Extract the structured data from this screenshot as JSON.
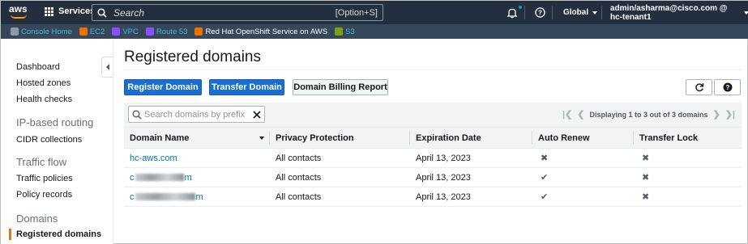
{
  "topnav": {
    "logo_text": "aws",
    "services_label": "Services",
    "search_placeholder": "Search",
    "search_shortcut": "[Option+S]",
    "region_label": "Global",
    "account_label": "admin/asharma@cisco.com @ hc-tenant1"
  },
  "favorites": [
    {
      "label": "Console Home",
      "color": "#8d99a8"
    },
    {
      "label": "EC2",
      "color": "#ed7100"
    },
    {
      "label": "VPC",
      "color": "#8c4fff"
    },
    {
      "label": "Route 53",
      "color": "#8c4fff"
    },
    {
      "label": "Red Hat OpenShift Service on AWS",
      "color": "#ed7100"
    },
    {
      "label": "S3",
      "color": "#7aa116"
    }
  ],
  "sidebar": {
    "dashboard": "Dashboard",
    "hosted_zones": "Hosted zones",
    "health_checks": "Health checks",
    "ip_routing_head": "IP-based routing",
    "cidr_collections": "CIDR collections",
    "traffic_flow_head": "Traffic flow",
    "traffic_policies": "Traffic policies",
    "policy_records": "Policy records",
    "domains_head": "Domains",
    "registered_domains": "Registered domains"
  },
  "main": {
    "title": "Registered domains",
    "register_button": "Register Domain",
    "transfer_button": "Transfer Domain",
    "billing_button": "Domain Billing Report",
    "filter_placeholder": "Search domains by prefix",
    "pager_text": "Displaying 1 to 3 out of 3 domains"
  },
  "table": {
    "columns": [
      "Domain Name",
      "Privacy Protection",
      "Expiration Date",
      "Auto Renew",
      "Transfer Lock"
    ],
    "rows": [
      {
        "domain": "hc-aws.com",
        "domain_prefix": "",
        "domain_suffix": "",
        "privacy": "All contacts",
        "expiration": "April 13, 2023",
        "auto_renew": "✖",
        "transfer_lock": "✖"
      },
      {
        "domain": "",
        "domain_prefix": "c",
        "domain_suffix": "m",
        "privacy": "All contacts",
        "expiration": "April 13, 2023",
        "auto_renew": "✔",
        "transfer_lock": "✖"
      },
      {
        "domain": "",
        "domain_prefix": "c",
        "domain_suffix": "m",
        "privacy": "All contacts",
        "expiration": "April 13, 2023",
        "auto_renew": "✔",
        "transfer_lock": "✖"
      }
    ]
  },
  "colors": {
    "nav_bg": "#232f3e",
    "fav_bg": "#37475a",
    "primary": "#1a6dd1",
    "link": "#0073bb",
    "active_marker": "#ec7211"
  }
}
